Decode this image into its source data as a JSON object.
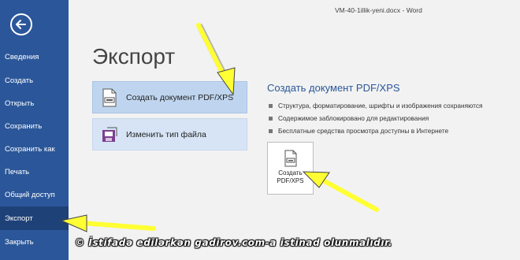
{
  "window": {
    "title": "VM-40-1illik-yeni.docx - Word"
  },
  "sidebar": {
    "items": [
      {
        "label": "Сведения"
      },
      {
        "label": "Создать"
      },
      {
        "label": "Открыть"
      },
      {
        "label": "Сохранить"
      },
      {
        "label": "Сохранить как"
      },
      {
        "label": "Печать"
      },
      {
        "label": "Общий доступ"
      },
      {
        "label": "Экспорт",
        "active": true
      },
      {
        "label": "Закрыть"
      }
    ]
  },
  "main": {
    "title": "Экспорт",
    "options": [
      {
        "label": "Создать документ PDF/XPS",
        "icon": "pdf-document-icon",
        "selected": true
      },
      {
        "label": "Изменить тип файла",
        "icon": "change-file-type-icon",
        "selected": false
      }
    ],
    "detail": {
      "title": "Создать документ PDF/XPS",
      "bullets": [
        "Структура, форматирование, шрифты и изображения сохраняются",
        "Содержимое заблокировано для редактирования",
        "Бесплатные средства просмотра доступны в Интернете"
      ],
      "button": {
        "line1": "Создать",
        "line2": "PDF/XPS"
      }
    }
  },
  "watermark": "© İstifadə edilərkən gadirov.com-a istinad olunmalıdır.",
  "colors": {
    "sidebar": "#2b579a",
    "sidebar_active": "#1e4178",
    "accent": "#2b579a",
    "arrow": "#ffff33",
    "option_bg": "#d6e4f5"
  }
}
